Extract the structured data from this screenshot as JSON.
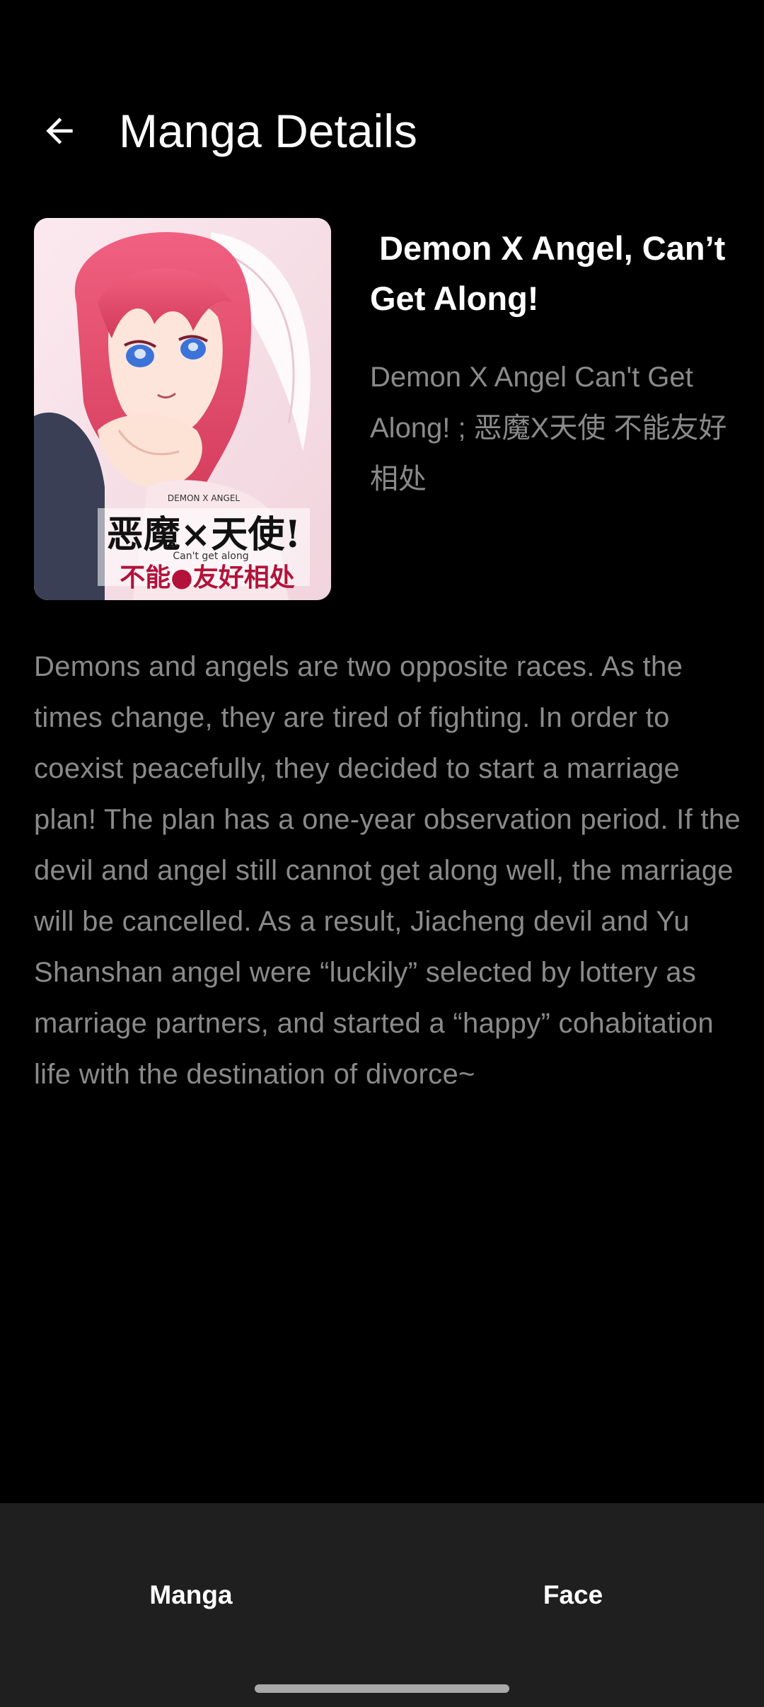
{
  "header": {
    "title": "Manga Details",
    "back_icon": "arrow-left-icon"
  },
  "manga": {
    "title": " Demon X Angel, Can’t Get Along!",
    "alt_names": "Demon X Angel Can't Get Along! ; 恶魔X天使 不能友好相处",
    "description": "Demons and angels are two opposite races. As the times change, they are tired of fighting. In order to coexist peacefully, they decided to start a marriage plan! The plan has a one-year observation period. If the devil and angel still cannot get along well, the marriage will be cancelled. As a result, Jiacheng devil and Yu Shanshan angel were “luckily” selected by lottery as marriage partners, and started a “happy” cohabitation life with the destination of divorce~",
    "cover": {
      "title_cn_line1": "恶魔×天使!",
      "title_cn_line2": "不能●友好相处",
      "title_en_small": "Can't get along",
      "title_en_top": "DEMON X ANGEL"
    }
  },
  "bottom_nav": {
    "items": [
      {
        "label": "Manga"
      },
      {
        "label": "Face"
      }
    ]
  },
  "colors": {
    "background": "#000000",
    "nav_background": "#1f1f1f",
    "secondary_text": "#8a8a8a",
    "hair_accent": "#e0466a"
  }
}
